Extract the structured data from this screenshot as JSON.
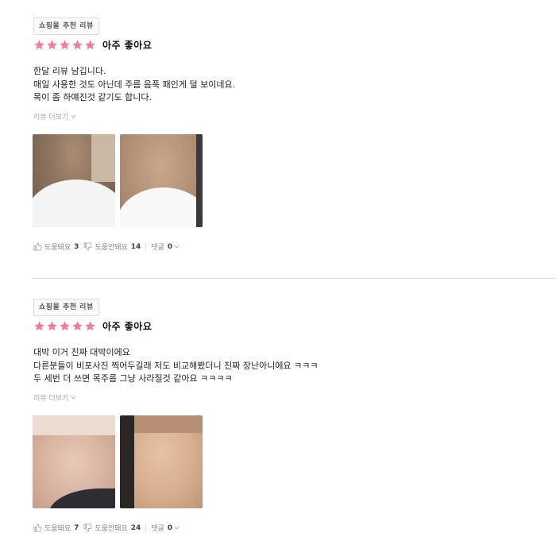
{
  "colors": {
    "star": "#f27c95",
    "text": "#222222",
    "muted": "#888888"
  },
  "reviews": [
    {
      "badge": "쇼핑몰 추천 리뷰",
      "stars": 5,
      "rating_label": "아주 좋아요",
      "lines": [
        "한달 리뷰 남깁니다.",
        "매일 사용한 것도 아닌데 주름 음푹 패인게 덜 보이네요.",
        "목이 좀 하얘진것 같기도 합니다."
      ],
      "more_label": "리뷰 더보기",
      "photos": [
        "neck-photo-before",
        "neck-photo-after"
      ],
      "helpful_label": "도움돼요",
      "helpful_count": "3",
      "not_helpful_label": "도움안돼요",
      "not_helpful_count": "14",
      "comments_label": "댓글",
      "comments_count": "0"
    },
    {
      "badge": "쇼핑몰 추천 리뷰",
      "stars": 5,
      "rating_label": "아주 좋아요",
      "lines": [
        "대박 이거 진짜 대박이에요",
        "다른분들이 비포사진 찍어두길래 저도 비교해봤더니 진짜 장난아니에요 ㅋㅋㅋ",
        "두 세번 더 쓰면 목주름 그냥 사라질것 같아요 ㅋㅋㅋㅋ"
      ],
      "more_label": "리뷰 더보기",
      "photos": [
        "neck-photo-before",
        "neck-photo-after"
      ],
      "helpful_label": "도움돼요",
      "helpful_count": "7",
      "not_helpful_label": "도움안돼요",
      "not_helpful_count": "24",
      "comments_label": "댓글",
      "comments_count": "0"
    }
  ]
}
